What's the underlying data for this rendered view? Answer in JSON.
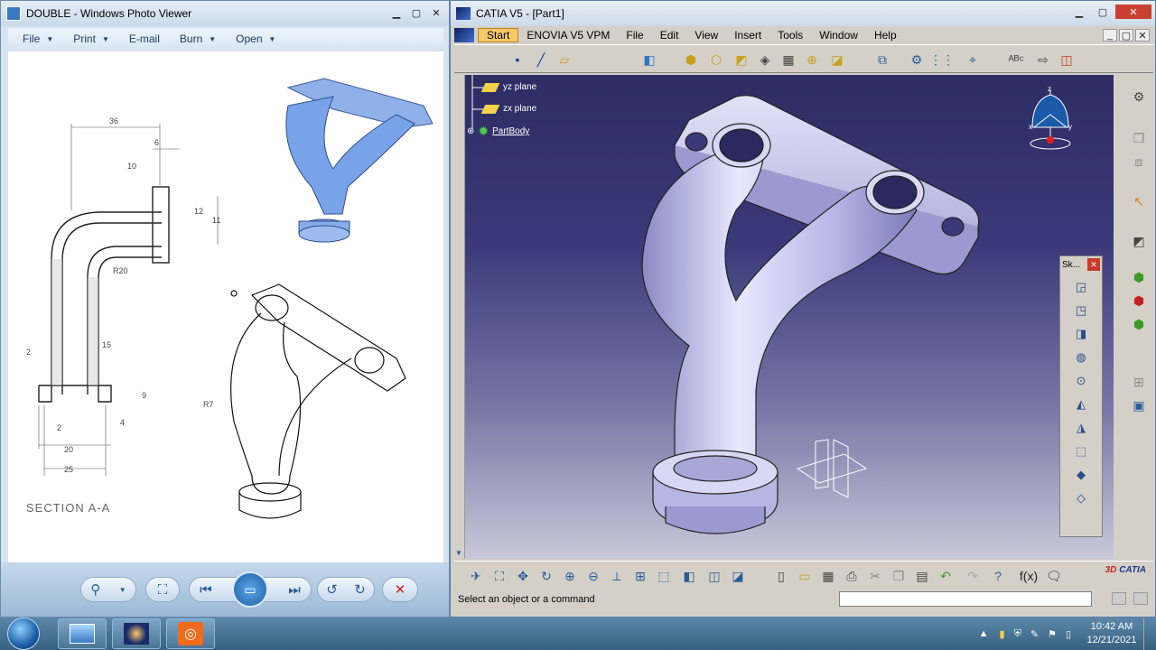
{
  "photo_viewer": {
    "title": "DOUBLE - Windows Photo Viewer",
    "menu": [
      {
        "label": "File",
        "has_dropdown": true
      },
      {
        "label": "Print",
        "has_dropdown": true
      },
      {
        "label": "E-mail",
        "has_dropdown": false
      },
      {
        "label": "Burn",
        "has_dropdown": true
      },
      {
        "label": "Open",
        "has_dropdown": true
      }
    ],
    "drawing": {
      "section_label": "SECTION A-A",
      "dims": [
        "36",
        "6",
        "10",
        "12",
        "11",
        "R20",
        "15",
        "2",
        "9",
        "2",
        "4",
        "20",
        "25",
        "R7"
      ]
    },
    "controls": [
      "zoom-icon",
      "actual-size-icon",
      "previous-icon",
      "slideshow-icon",
      "next-icon",
      "rotate-ccw-icon",
      "rotate-cw-icon",
      "delete-icon"
    ]
  },
  "catia": {
    "title": "CATIA V5 - [Part1]",
    "menu": [
      "Start",
      "ENOVIA V5 VPM",
      "File",
      "Edit",
      "View",
      "Insert",
      "Tools",
      "Window",
      "Help"
    ],
    "tree": [
      {
        "label": "yz plane",
        "icon": "plane-icon"
      },
      {
        "label": "zx plane",
        "icon": "plane-icon"
      },
      {
        "label": "PartBody",
        "icon": "gear-icon"
      }
    ],
    "sketch_panel_title": "Sk...",
    "status_text": "Select an object or a command",
    "axis_labels": [
      "z",
      "x",
      "y"
    ],
    "brand": "CATIA"
  },
  "taskbar": {
    "time": "10:42 AM",
    "date": "12/21/2021",
    "apps": [
      "photo-viewer-icon",
      "catia-icon",
      "recorder-icon"
    ]
  },
  "colors": {
    "viewport_top": "#2d2c63",
    "part_fill": "#c9c9ee",
    "menu_active": "#f5c86a"
  }
}
